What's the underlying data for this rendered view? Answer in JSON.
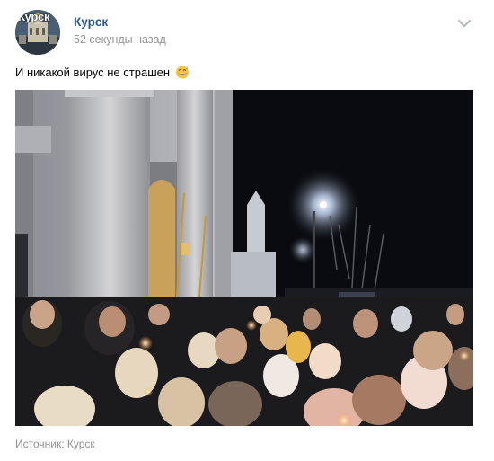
{
  "post": {
    "avatar_text": "Курск",
    "author": "Курск",
    "time": "52 секунды назад",
    "text": "И никакой вирус не страшен",
    "emoji_icon": "grinning-face-with-sweat-emoji",
    "source_label": "Источник:",
    "source_link": "Курск"
  },
  "colors": {
    "link": "#2a5885",
    "meta": "#939393",
    "chevron": "#aeb7c2"
  }
}
